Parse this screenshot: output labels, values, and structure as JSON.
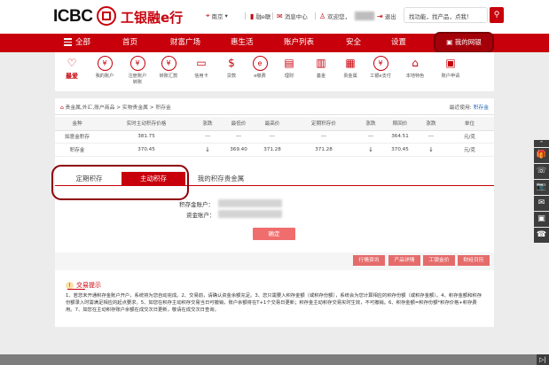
{
  "header": {
    "logo_text": "ICBC",
    "logo_cn": "工银融e行",
    "location": "南京",
    "emessenger": "融e联",
    "message_center": "消息中心",
    "welcome": "欢迎您，",
    "logout": "退出",
    "search_text": "找功能，找产品，点我！",
    "search_icon_glyph": "⚲"
  },
  "nav": {
    "items": [
      "全部",
      "首页",
      "财富广场",
      "惠生活",
      "账户列表",
      "安全",
      "设置"
    ],
    "mine": "我的网银"
  },
  "quick_icons": [
    {
      "label": "最爱",
      "icon": "heart-icon",
      "glyph": "♡"
    },
    {
      "label": "我的账户",
      "icon": "yuan-circle-icon",
      "glyph": "¥"
    },
    {
      "label": "注册账户转账",
      "icon": "yuan-circle-icon",
      "glyph": "¥"
    },
    {
      "label": "转账汇款",
      "icon": "yuan-circle-icon",
      "glyph": "¥"
    },
    {
      "label": "信用卡",
      "icon": "card-icon",
      "glyph": "▭"
    },
    {
      "label": "贷款",
      "icon": "money-bag-icon",
      "glyph": "$"
    },
    {
      "label": "e缴费",
      "icon": "drop-icon",
      "glyph": "e"
    },
    {
      "label": "理财",
      "icon": "wallet-icon",
      "glyph": "▤"
    },
    {
      "label": "基金",
      "icon": "bar-chart-icon",
      "glyph": "▥"
    },
    {
      "label": "贵金属",
      "icon": "gold-bars-icon",
      "glyph": "▦"
    },
    {
      "label": "工银e支付",
      "icon": "pay-icon",
      "glyph": "¥"
    },
    {
      "label": "本地特色",
      "icon": "building-icon",
      "glyph": "⌂"
    },
    {
      "label": "账户申请",
      "icon": "form-icon",
      "glyph": "▣"
    }
  ],
  "breadcrumb": {
    "path": "贵金属,外汇,账户商品 > 实物贵金属 > 积存金",
    "recent_label": "最近使用:",
    "recent_link": "积存金"
  },
  "price_table": {
    "headers": [
      "金种",
      "实时主动积存价格",
      "涨跌",
      "最低价",
      "最高价",
      "定期积存价",
      "涨跌",
      "赎回价",
      "涨跌",
      "单位"
    ],
    "rows": [
      [
        "如意金积存",
        "381.75",
        "---",
        "---",
        "---",
        "---",
        "---",
        "364.51",
        "---",
        "元/克"
      ],
      [
        "积存金",
        "370.45",
        "↓",
        "369.40",
        "371.28",
        "371.28",
        "↓",
        "370.45",
        "↓",
        "元/克"
      ]
    ]
  },
  "tabs": [
    "定期积存",
    "主动积存",
    "我的积存贵金属"
  ],
  "form": {
    "gold_account_label": "积存金账户：",
    "fund_account_label": "资金账户：",
    "confirm": "确定"
  },
  "action_buttons": [
    "行情资讯",
    "产品详情",
    "工银金价",
    "财经日历"
  ],
  "tips": {
    "title": "交易提示",
    "icon_glyph": "!",
    "body": "1、若您未开通积存金账户开户，系统将为您自动完成。2、交易前，请确认资金余额充足。3、您只需要入积存金额（或积存份额），系统会为您计算相应的积存份额（或积存金额）。4、积存金额和积存份额录入时需满足相应的起点要求。5、如您在积存主动积存交易当日可撤销，账户余额将在T+1个交易日更新；积存金主动积存交易实时生效，不可撤销。6、积存金额=积存份额*积存价格+积存费用。7、如您在主动积存账户余额在成交次日更新，敬请在成交次日查询。"
  },
  "side_tools": [
    "^",
    "🎁",
    "☏",
    "📷",
    "✉",
    "▣",
    "☎"
  ],
  "bottom_icon": "▷|"
}
